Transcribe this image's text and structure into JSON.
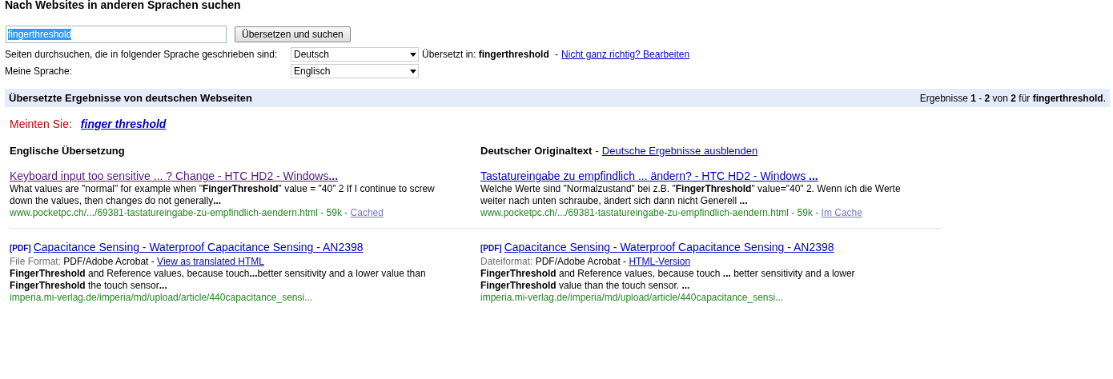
{
  "heading": "Nach Websites in anderen Sprachen suchen",
  "search": {
    "value": "fingerthreshold",
    "value_selected": true,
    "button": "Übersetzen und suchen"
  },
  "options": [
    {
      "label": "Seiten durchsuchen, die in folgender Sprache geschrieben sind:",
      "value": "Deutsch",
      "note": "Übersetzt in: **fingerthreshold**",
      "separator": "-",
      "note_link": "Nicht ganz richtig? Bearbeiten"
    },
    {
      "label": "Meine Sprache:",
      "value": "Englisch"
    }
  ],
  "results_bar": {
    "title": "Übersetzte Ergebnisse von deutschen Webseiten",
    "count": "Ergebnisse **1** - **2** von **2** für **fingerthreshold**."
  },
  "suggestion": {
    "label": "Meinten Sie:",
    "link": "finger threshold"
  },
  "columns": [
    {
      "title": "Englische Übersetzung"
    },
    {
      "title": "Deutscher Originaltext",
      "separator": "-",
      "link": "Deutsche Ergebnisse ausblenden"
    }
  ],
  "results": [
    [
      {
        "title": "Keyboard input too sensitive ... ? Change - HTC HD2 - Windows**...**",
        "visited": true,
        "snippet": "What values are \"normal\" for example when \"**FingerThreshold**\" value = \"40\" 2 If I continue to screw down the values, then changes do not generally**...**",
        "url": "www.pocketpc.ch/.../69381-tastatureingabe-zu-empfindlich-aendern.html - 59k - ",
        "cache": "Cached"
      },
      {
        "title": "Tastatureingabe zu empfindlich ... ändern? - HTC HD2 - Windows **...**",
        "visited": false,
        "snippet": "Welche Werte sind \"Normalzustand\" bei z.B. \"**FingerThreshold**\" value=\"40\" 2. Wenn ich die Werte weiter nach unten schraube, ändert sich dann nicht Generell **...**",
        "url": "www.pocketpc.ch/.../69381-tastatureingabe-zu-empfindlich-aendern.html - 59k - ",
        "cache": "Im Cache"
      }
    ],
    [
      {
        "tag": "[PDF]",
        "title": "Capacitance Sensing - Waterproof Capacitance Sensing - AN2398",
        "visited": false,
        "format_label": "File Format:",
        "format": "PDF/Adobe Acrobat - ",
        "format_link": "View as translated HTML",
        "snippet": "**FingerThreshold** and Reference values, because touch**...**better sensitivity and a lower value than **FingerThreshold** the touch sensor**...**",
        "url": "imperia.mi-verlag.de/imperia/md/upload/article/440capacitance_sensi..."
      },
      {
        "tag": "[PDF]",
        "title": "Capacitance Sensing - Waterproof Capacitance Sensing - AN2398",
        "visited": false,
        "format_label": "Dateiformat:",
        "format": "PDF/Adobe Acrobat - ",
        "format_link": "HTML-Version",
        "snippet": "**FingerThreshold** and Reference values, because touch **...** better sensitivity and a lower **FingerThreshold** value than the touch sensor. **...**",
        "url": "imperia.mi-verlag.de/imperia/md/upload/article/440capacitance_sensi..."
      }
    ]
  ]
}
